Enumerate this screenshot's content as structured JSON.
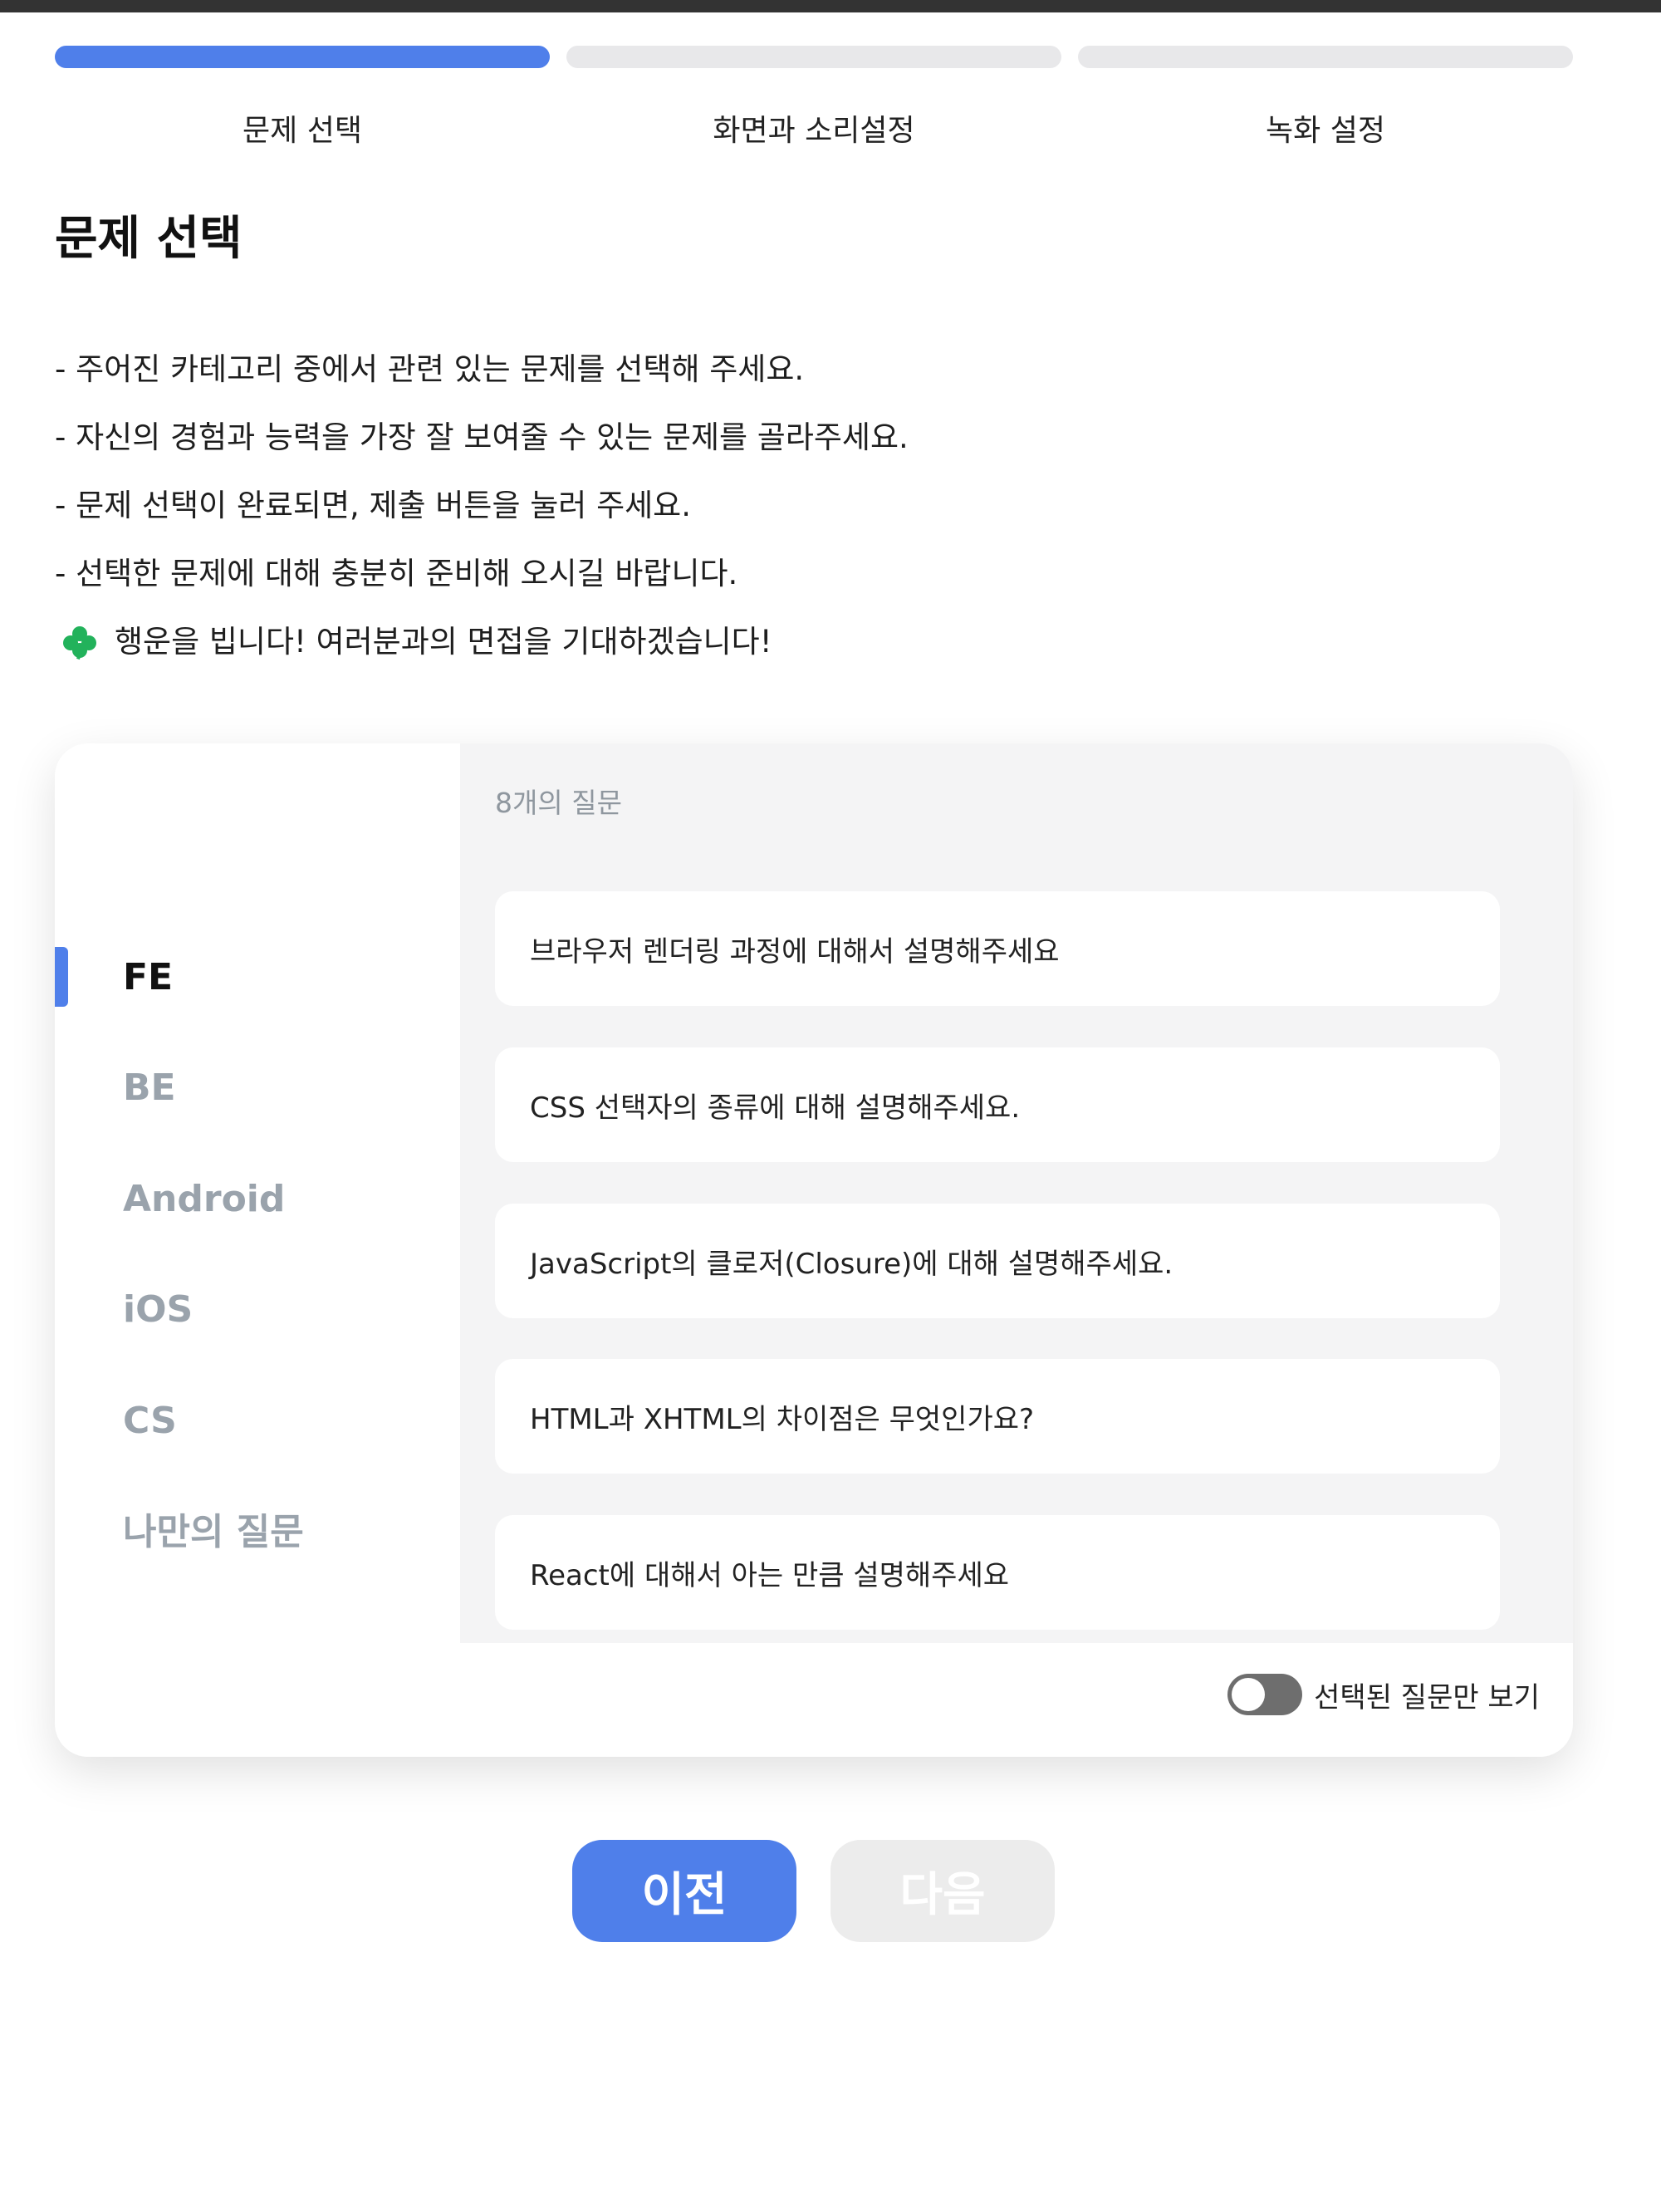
{
  "progress": {
    "steps": [
      "문제 선택",
      "화면과 소리설정",
      "녹화 설정"
    ],
    "active_step": 0
  },
  "page_title": "문제 선택",
  "instructions": [
    "- 주어진 카테고리 중에서 관련 있는 문제를 선택해 주세요.",
    "- 자신의 경험과 능력을 가장 잘 보여줄 수 있는 문제를 골라주세요.",
    "- 문제 선택이 완료되면, 제출 버튼을 눌러 주세요.",
    "- 선택한 문제에 대해 충분히 준비해 오시길 바랍니다."
  ],
  "good_luck": "행운을 빕니다! 여러분과의 면접을 기대하겠습니다!",
  "categories": [
    "FE",
    "BE",
    "Android",
    "iOS",
    "CS",
    "나만의 질문"
  ],
  "active_category": "FE",
  "question_count": "8개의 질문",
  "questions": [
    "브라우저 렌더링 과정에 대해서 설명해주세요",
    "CSS 선택자의 종류에 대해 설명해주세요.",
    "JavaScript의 클로저(Closure)에 대해 설명해주세요.",
    "HTML과 XHTML의 차이점은 무엇인가요?",
    "React에 대해서 아는 만큼 설명해주세요"
  ],
  "toggle": {
    "label": "선택된 질문만 보기",
    "on": false
  },
  "buttons": {
    "prev": "이전",
    "next": "다음"
  },
  "colors": {
    "accent": "#4f7fea",
    "disabled": "#ececec",
    "clover": "#22b25b"
  }
}
